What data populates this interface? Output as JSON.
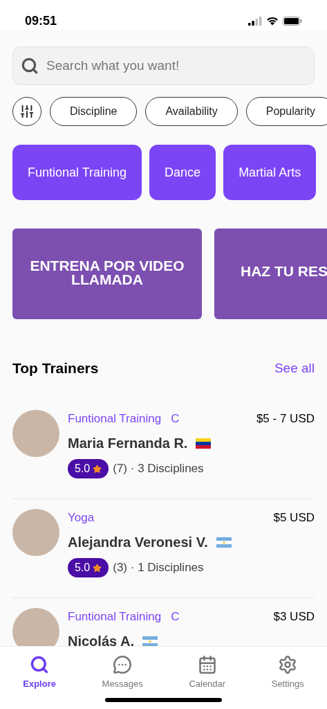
{
  "status_bar": {
    "time": "09:51"
  },
  "search": {
    "placeholder": "Search what you want!"
  },
  "filters": [
    {
      "label": "Discipline"
    },
    {
      "label": "Availability"
    },
    {
      "label": "Popularity"
    }
  ],
  "categories": [
    {
      "label": "Funtional Training"
    },
    {
      "label": "Dance"
    },
    {
      "label": "Martial Arts"
    }
  ],
  "banners": [
    {
      "title": "ENTRENA POR VIDEO LLAMADA"
    },
    {
      "title": "HAZ TU RES"
    }
  ],
  "section": {
    "title": "Top Trainers",
    "link": "See all"
  },
  "trainers": [
    {
      "disciplines": [
        "Funtional Training",
        "C"
      ],
      "name": "Maria Fernanda R.",
      "flag": {
        "kind": "ve"
      },
      "price": "$5 - 7 USD",
      "rating": "5.0",
      "meta": "(7) · 3 Disciplines"
    },
    {
      "disciplines": [
        "Yoga"
      ],
      "name": "Alejandra Veronesi V.",
      "flag": {
        "kind": "ar"
      },
      "price": "$5 USD",
      "rating": "5.0",
      "meta": "(3) · 1 Disciplines"
    },
    {
      "disciplines": [
        "Funtional Training",
        "C"
      ],
      "name": "Nicolás A.",
      "flag": {
        "kind": "ar"
      },
      "price": "$3 USD"
    }
  ],
  "tabs": [
    {
      "label": "Explore",
      "selected": true
    },
    {
      "label": "Messages",
      "selected": false
    },
    {
      "label": "Calendar",
      "selected": false
    },
    {
      "label": "Settings",
      "selected": false
    }
  ]
}
